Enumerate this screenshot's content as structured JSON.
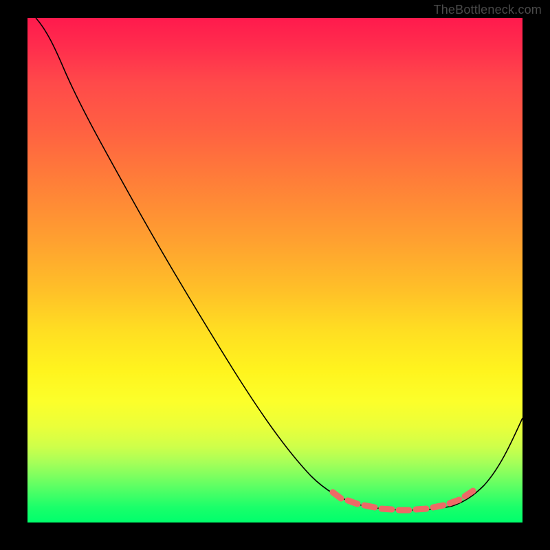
{
  "watermark": "TheBottleneck.com",
  "chart_data": {
    "type": "line",
    "title": "",
    "xlabel": "",
    "ylabel": "",
    "xlim": [
      0,
      100
    ],
    "ylim": [
      0,
      100
    ],
    "grid": false,
    "legend": false,
    "series": [
      {
        "name": "bottleneck-curve",
        "x": [
          0,
          5,
          10,
          15,
          20,
          25,
          30,
          35,
          40,
          45,
          50,
          55,
          60,
          62,
          65,
          70,
          75,
          78,
          80,
          83,
          86,
          90,
          95,
          100
        ],
        "y": [
          100,
          96,
          90.5,
          84,
          77,
          69.5,
          62,
          54.5,
          47,
          39.5,
          32,
          24.5,
          18,
          15,
          12,
          8,
          5,
          4,
          3.5,
          3.5,
          4,
          6,
          14,
          25
        ]
      }
    ],
    "highlight_region": {
      "name": "optimal-zone",
      "x": [
        62,
        86
      ],
      "note": "Tick-marked flat minimum of the curve"
    },
    "background_gradient": {
      "top_color": "#ff1a4d",
      "mid_color": "#ffde22",
      "bottom_color": "#00ff6c",
      "meaning": "Red = high bottleneck, Green = low bottleneck"
    }
  }
}
